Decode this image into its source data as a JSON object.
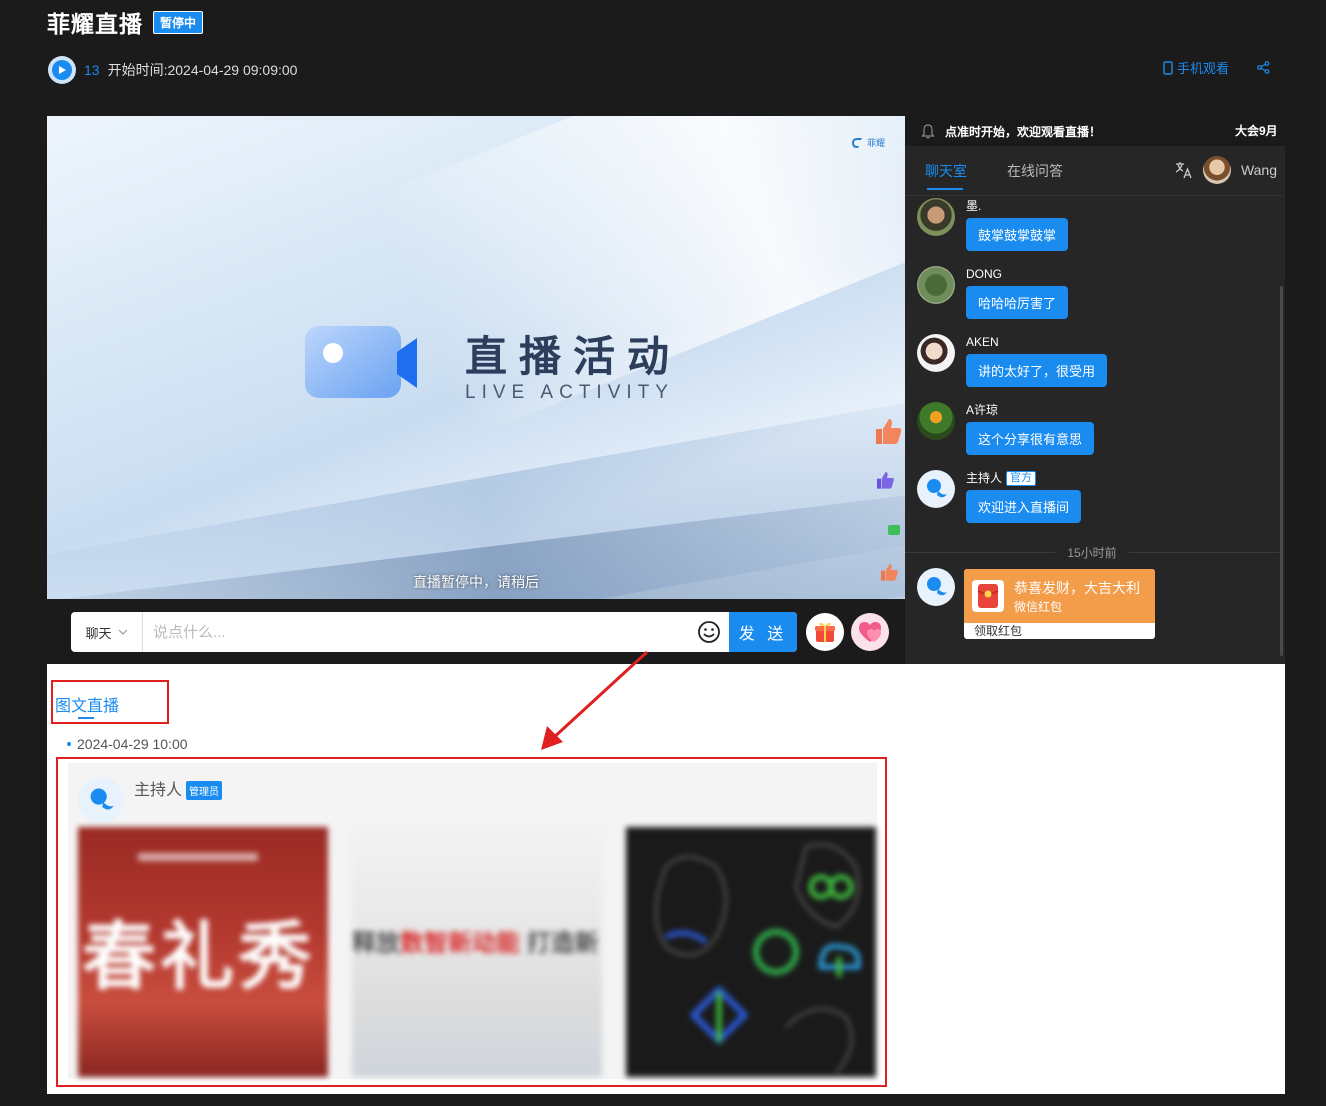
{
  "header": {
    "title": "菲耀直播",
    "status_badge": "暂停中",
    "viewer_count": "13",
    "start_time": "开始时间:2024-04-29 09:09:00",
    "mobile_watch": "手机观看"
  },
  "video": {
    "logo_text": "菲耀",
    "headline": "直播活动",
    "subheadline": "LIVE ACTIVITY",
    "paused_message": "直播暂停中，请稍后"
  },
  "input_bar": {
    "channel": "聊天",
    "placeholder": "说点什么...",
    "send_label": "发 送"
  },
  "chat": {
    "notice": "点准时开始，欢迎观看直播！",
    "notice_right": "大会9月",
    "tabs": [
      "聊天室",
      "在线问答"
    ],
    "current_user": "Wang",
    "messages": [
      {
        "name": "墨.",
        "text": "鼓掌鼓掌鼓掌"
      },
      {
        "name": "DONG",
        "text": "哈哈哈厉害了"
      },
      {
        "name": "AKEN",
        "text": "讲的太好了，很受用"
      },
      {
        "name": "A许琼",
        "text": "这个分享很有意思"
      },
      {
        "name": "主持人",
        "tag": "官方",
        "text": "欢迎进入直播间"
      }
    ],
    "time_divider": "15小时前",
    "red_packet": {
      "title": "恭喜发财，大吉大利",
      "subtitle": "微信红包",
      "action": "领取红包"
    }
  },
  "content": {
    "tab": "图文直播",
    "post": {
      "date": "2024-04-29 10:00",
      "author": "主持人",
      "author_tag": "管理员",
      "image1_text": "春礼秀",
      "image2_text_a": "释放",
      "image2_text_b": "数智新动能",
      "image2_text_c": "打造新"
    }
  },
  "colors": {
    "accent": "#1a8cf0",
    "highlight_red": "#e02020",
    "background": "#1b1b1b",
    "chat_bg": "#262626",
    "red_packet": "#f39c4a"
  }
}
